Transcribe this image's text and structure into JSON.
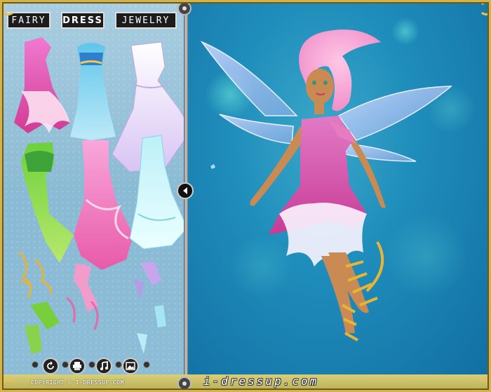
{
  "tabs": [
    {
      "label": "FAIRY"
    },
    {
      "label": "DRESS"
    },
    {
      "label": "JEWELRY"
    }
  ],
  "active_tab": "DRESS",
  "footer": {
    "copyright": "COPYRIGHT © I-DRESSUP.COM",
    "brand": "i-dressup.com"
  },
  "colors": {
    "stage_blue": "#1f8dbb",
    "panel_blue": "#9cc6dc",
    "gold_frame": "#d4b44a",
    "fairy_pink": "#ef9ad0"
  },
  "toolbar": {
    "icons": [
      "rotate-icon",
      "print-icon",
      "music-icon",
      "picture-icon"
    ]
  }
}
